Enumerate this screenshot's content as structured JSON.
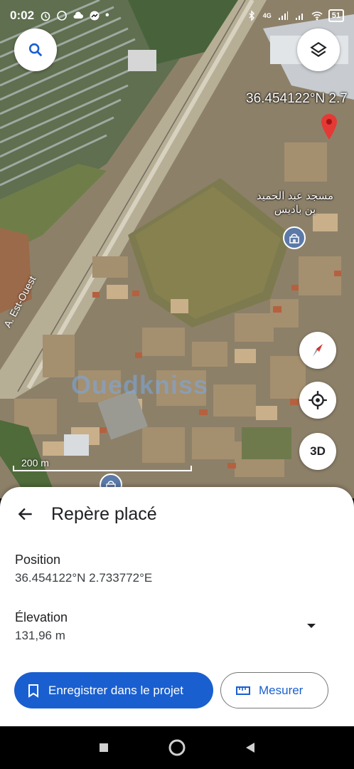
{
  "status_bar": {
    "time": "0:02",
    "network": "4G",
    "battery": "51"
  },
  "map": {
    "coords_overlay": "36.454122°N 2.7",
    "mosque_label_line1": "مسجد عبد الحميد",
    "mosque_label_line2": "بن باديس",
    "road_label": "A. Est-Ouest",
    "scale_label": "200 m",
    "watermark": "Ouedkniss",
    "three_d_label": "3D"
  },
  "sheet": {
    "title": "Repère placé",
    "position_label": "Position",
    "position_value": "36.454122°N 2.733772°E",
    "elevation_label": "Élevation",
    "elevation_value": "131,96 m",
    "save_button": "Enregistrer dans le projet",
    "measure_button": "Mesurer"
  },
  "colors": {
    "accent": "#1a5fcf",
    "pin": "#e53935"
  },
  "icons": [
    "search-icon",
    "layers-icon",
    "compass-icon",
    "my-location-icon",
    "mosque-icon",
    "pin-icon",
    "back-arrow-icon",
    "chevron-down-icon",
    "bookmark-icon",
    "ruler-icon"
  ]
}
